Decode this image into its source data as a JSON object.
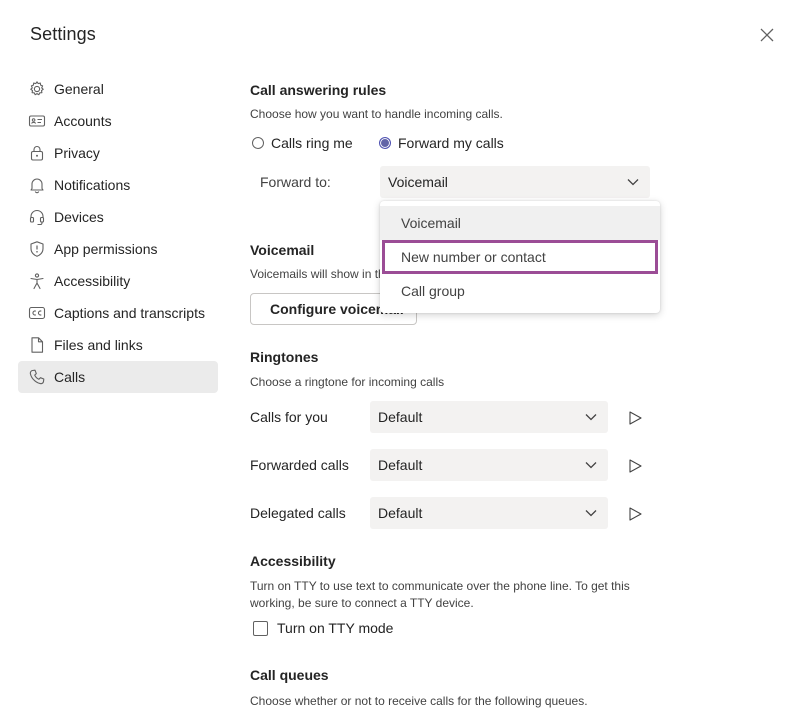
{
  "dialog": {
    "title": "Settings"
  },
  "sidebar": {
    "items": [
      {
        "label": "General",
        "icon": "gear-icon"
      },
      {
        "label": "Accounts",
        "icon": "id-card-icon"
      },
      {
        "label": "Privacy",
        "icon": "lock-icon"
      },
      {
        "label": "Notifications",
        "icon": "bell-icon"
      },
      {
        "label": "Devices",
        "icon": "headset-icon"
      },
      {
        "label": "App permissions",
        "icon": "shield-icon"
      },
      {
        "label": "Accessibility",
        "icon": "accessibility-icon"
      },
      {
        "label": "Captions and transcripts",
        "icon": "cc-icon"
      },
      {
        "label": "Files and links",
        "icon": "file-icon"
      },
      {
        "label": "Calls",
        "icon": "phone-icon",
        "active": true
      }
    ]
  },
  "call_answering": {
    "title": "Call answering rules",
    "description": "Choose how you want to handle incoming calls.",
    "option_ring": "Calls ring me",
    "option_forward": "Forward my calls",
    "selected": "Forward my calls",
    "forward_to_label": "Forward to:",
    "forward_to_value": "Voicemail",
    "dropdown_options": [
      "Voicemail",
      "New number or contact",
      "Call group"
    ]
  },
  "voicemail": {
    "title": "Voicemail",
    "description": "Voicemails will show in th",
    "button": "Configure voicemail"
  },
  "ringtones": {
    "title": "Ringtones",
    "description": "Choose a ringtone for incoming calls",
    "rows": [
      {
        "label": "Calls for you",
        "value": "Default"
      },
      {
        "label": "Forwarded calls",
        "value": "Default"
      },
      {
        "label": "Delegated calls",
        "value": "Default"
      }
    ]
  },
  "accessibility": {
    "title": "Accessibility",
    "description_line1": "Turn on TTY to use text to communicate over the phone line. To get this",
    "description_line2": "working, be sure to connect a TTY device.",
    "checkbox_label": "Turn on TTY mode",
    "checked": false
  },
  "call_queues": {
    "title": "Call queues",
    "description": "Choose whether or not to receive calls for the following queues."
  },
  "colors": {
    "accent": "#6264a7",
    "focus_ring": "#9b4d96",
    "active_nav_bg": "#ebebeb",
    "select_bg": "#f3f2f1"
  }
}
